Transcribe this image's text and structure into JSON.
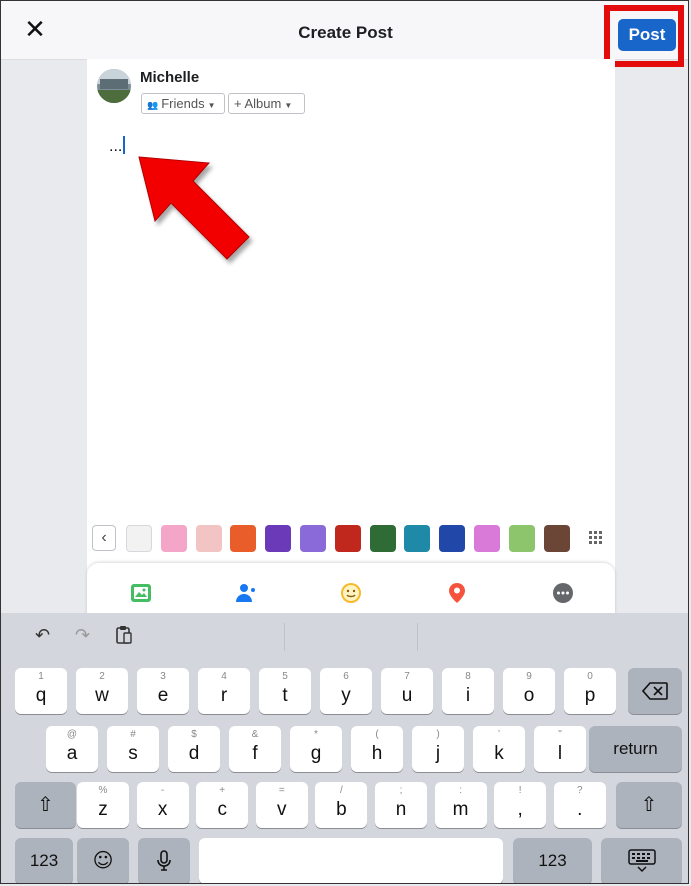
{
  "header": {
    "close_icon": "close-icon",
    "title": "Create Post",
    "post_label": "Post",
    "highlight_color": "#e30b0b",
    "accent_color": "#1866c9"
  },
  "composer": {
    "user_name": "Michelle",
    "audience_label": "Friends",
    "album_label": "+ Album",
    "text": "...",
    "annotation_arrow": "red-arrow-pointing-at-cursor"
  },
  "backgrounds": {
    "back_icon": "chevron-left-icon",
    "grid_icon": "grid-icon",
    "swatches": [
      {
        "name": "plain-white",
        "color": "#f2f2f2"
      },
      {
        "name": "pink-donut",
        "color": "#f4a6c8"
      },
      {
        "name": "light-pink",
        "color": "#f2c4c4"
      },
      {
        "name": "orange",
        "color": "#e85d2a"
      },
      {
        "name": "purple-pattern",
        "color": "#6b3ab8"
      },
      {
        "name": "violet",
        "color": "#8a6ad8"
      },
      {
        "name": "red-heart",
        "color": "#c0281e"
      },
      {
        "name": "green-pattern",
        "color": "#2f6b35"
      },
      {
        "name": "teal-pattern",
        "color": "#1e8aa8"
      },
      {
        "name": "blue-orb",
        "color": "#2148a8"
      },
      {
        "name": "watermelon",
        "color": "#d97ad8"
      },
      {
        "name": "avocado",
        "color": "#8cc56c"
      },
      {
        "name": "brown-emoji",
        "color": "#6b4636"
      }
    ]
  },
  "actions": [
    {
      "name": "photo-icon",
      "color": "#45bd62"
    },
    {
      "name": "tag-people-icon",
      "color": "#1877f2"
    },
    {
      "name": "feeling-icon",
      "color": "#f7b928"
    },
    {
      "name": "check-in-icon",
      "color": "#f5533d"
    },
    {
      "name": "more-icon",
      "color": "#65676b"
    }
  ],
  "keyboard": {
    "toolbar": {
      "undo_icon": "undo-icon",
      "redo_icon": "redo-icon",
      "paste_icon": "clipboard-icon"
    },
    "row1": [
      {
        "main": "q",
        "alt": "1"
      },
      {
        "main": "w",
        "alt": "2"
      },
      {
        "main": "e",
        "alt": "3"
      },
      {
        "main": "r",
        "alt": "4"
      },
      {
        "main": "t",
        "alt": "5"
      },
      {
        "main": "y",
        "alt": "6"
      },
      {
        "main": "u",
        "alt": "7"
      },
      {
        "main": "i",
        "alt": "8"
      },
      {
        "main": "o",
        "alt": "9"
      },
      {
        "main": "p",
        "alt": "0"
      }
    ],
    "row2": [
      {
        "main": "a",
        "alt": "@"
      },
      {
        "main": "s",
        "alt": "#"
      },
      {
        "main": "d",
        "alt": "$"
      },
      {
        "main": "f",
        "alt": "&"
      },
      {
        "main": "g",
        "alt": "*"
      },
      {
        "main": "h",
        "alt": "("
      },
      {
        "main": "j",
        "alt": ")"
      },
      {
        "main": "k",
        "alt": "’"
      },
      {
        "main": "l",
        "alt": "\""
      }
    ],
    "row3": [
      {
        "main": "z",
        "alt": "%"
      },
      {
        "main": "x",
        "alt": "-"
      },
      {
        "main": "c",
        "alt": "+"
      },
      {
        "main": "v",
        "alt": "="
      },
      {
        "main": "b",
        "alt": "/"
      },
      {
        "main": "n",
        "alt": ";"
      },
      {
        "main": "m",
        "alt": ":"
      },
      {
        "main": ",",
        "alt": "!"
      },
      {
        "main": ".",
        "alt": "?"
      }
    ],
    "return_label": "return",
    "numbers_label": "123",
    "backspace_icon": "backspace-icon",
    "shift_icon": "shift-icon",
    "emoji_icon": "emoji-icon",
    "mic_icon": "microphone-icon",
    "hide_keyboard_icon": "keyboard-hide-icon"
  }
}
